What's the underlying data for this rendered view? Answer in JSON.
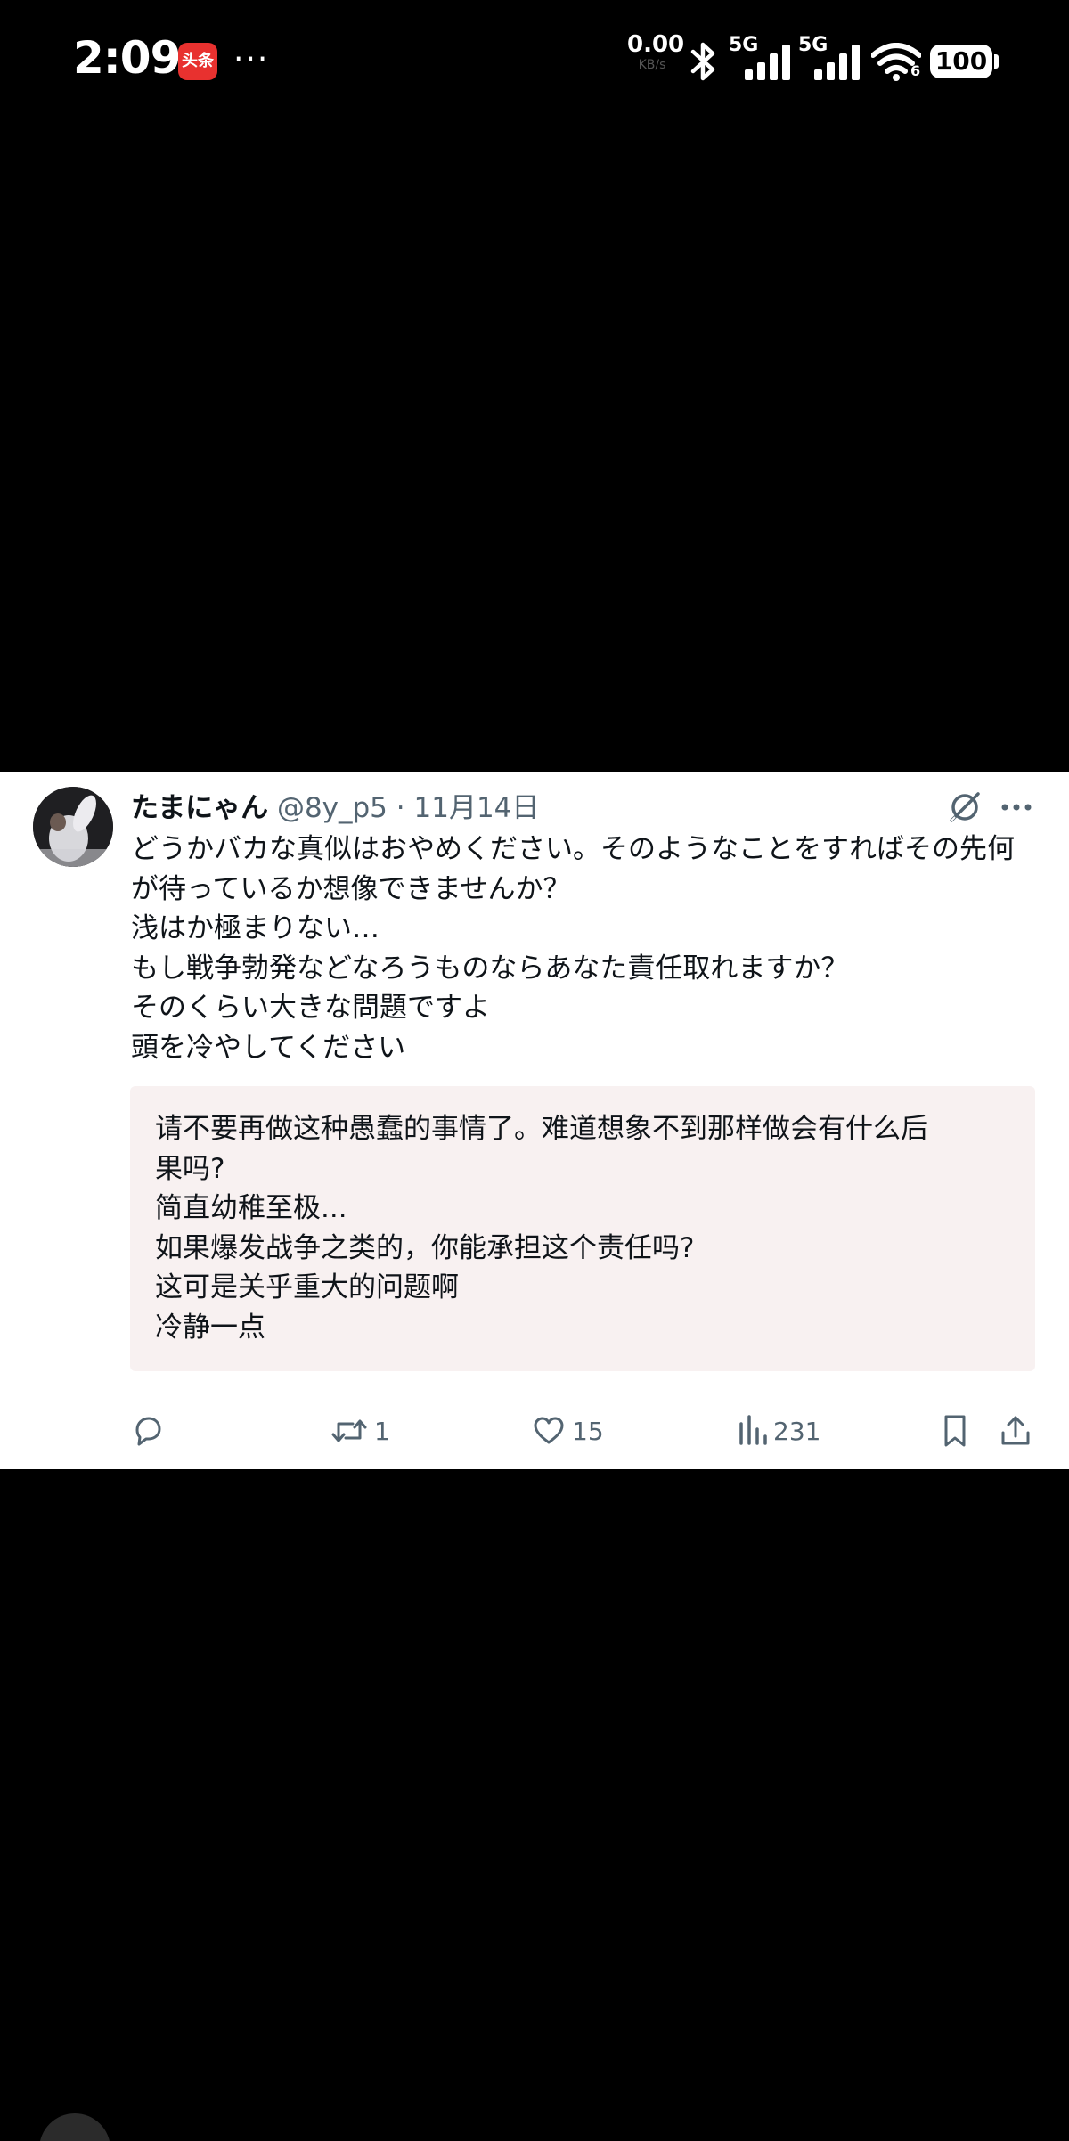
{
  "status_bar": {
    "time": "2:09",
    "app_icon_text": "头条",
    "overflow": "···",
    "net_speed_value": "0.00",
    "net_speed_unit": "KB/s",
    "network_1": "5G",
    "network_2": "5G",
    "wifi_sub": "6",
    "battery": "100"
  },
  "tweet": {
    "author_name": "たまにゃん",
    "handle": "@8y_p5",
    "separator": "·",
    "date": "11月14日",
    "text_lines": [
      "どうかバカな真似はおやめください。そのようなことをすればその先何",
      "が待っているか想像できませんか？",
      "浅はか極まりない…",
      "もし戦争勃発などなろうものならあなた責任取れますか？",
      "そのくらい大きな問題ですよ",
      "頭を冷やしてください"
    ],
    "translation_lines": [
      "请不要再做这种愚蠢的事情了。难道想象不到那样做会有什么后",
      "果吗?",
      "简直幼稚至极...",
      "如果爆发战争之类的，你能承担这个责任吗?",
      "这可是关乎重大的问题啊",
      "冷静一点"
    ],
    "actions": {
      "reply": "",
      "retweets": "1",
      "likes": "15",
      "views": "231"
    }
  },
  "colors": {
    "text_primary": "#0f1419",
    "text_secondary": "#536471",
    "translation_bg": "#f8f1f1",
    "app_icon": "#e8312f"
  }
}
